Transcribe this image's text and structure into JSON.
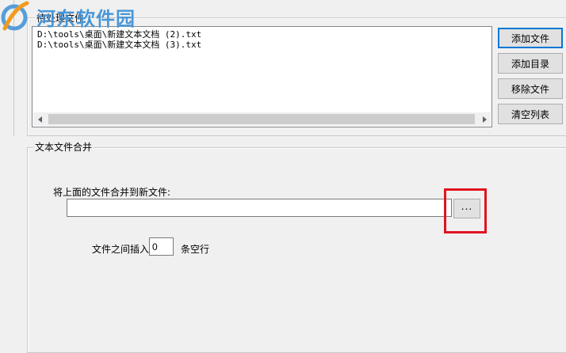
{
  "watermark": {
    "text": "河东软件园"
  },
  "files_group": {
    "title": "待处理文件",
    "files": [
      "D:\\tools\\桌面\\新建文本文档 (2).txt",
      "D:\\tools\\桌面\\新建文本文档 (3).txt"
    ]
  },
  "buttons": {
    "add_file": "添加文件",
    "add_dir": "添加目录",
    "remove_file": "移除文件",
    "clear_list": "清空列表"
  },
  "merge_group": {
    "title": "文本文件合并",
    "output_label": "将上面的文件合并到新文件:",
    "output_value": "",
    "browse_label": "...",
    "insert_prefix": "文件之间插入",
    "blank_lines": "0",
    "insert_suffix": "条空行"
  },
  "colors": {
    "window_bg": "#f0f0f0",
    "highlight_box": "#e0141e",
    "focus_border": "#0078d7",
    "watermark": "#3b8fd6"
  },
  "icons": {
    "watermark_logo": "watermark-logo-icon",
    "scroll_left": "scroll-left-arrow-icon",
    "scroll_right": "scroll-right-arrow-icon"
  }
}
